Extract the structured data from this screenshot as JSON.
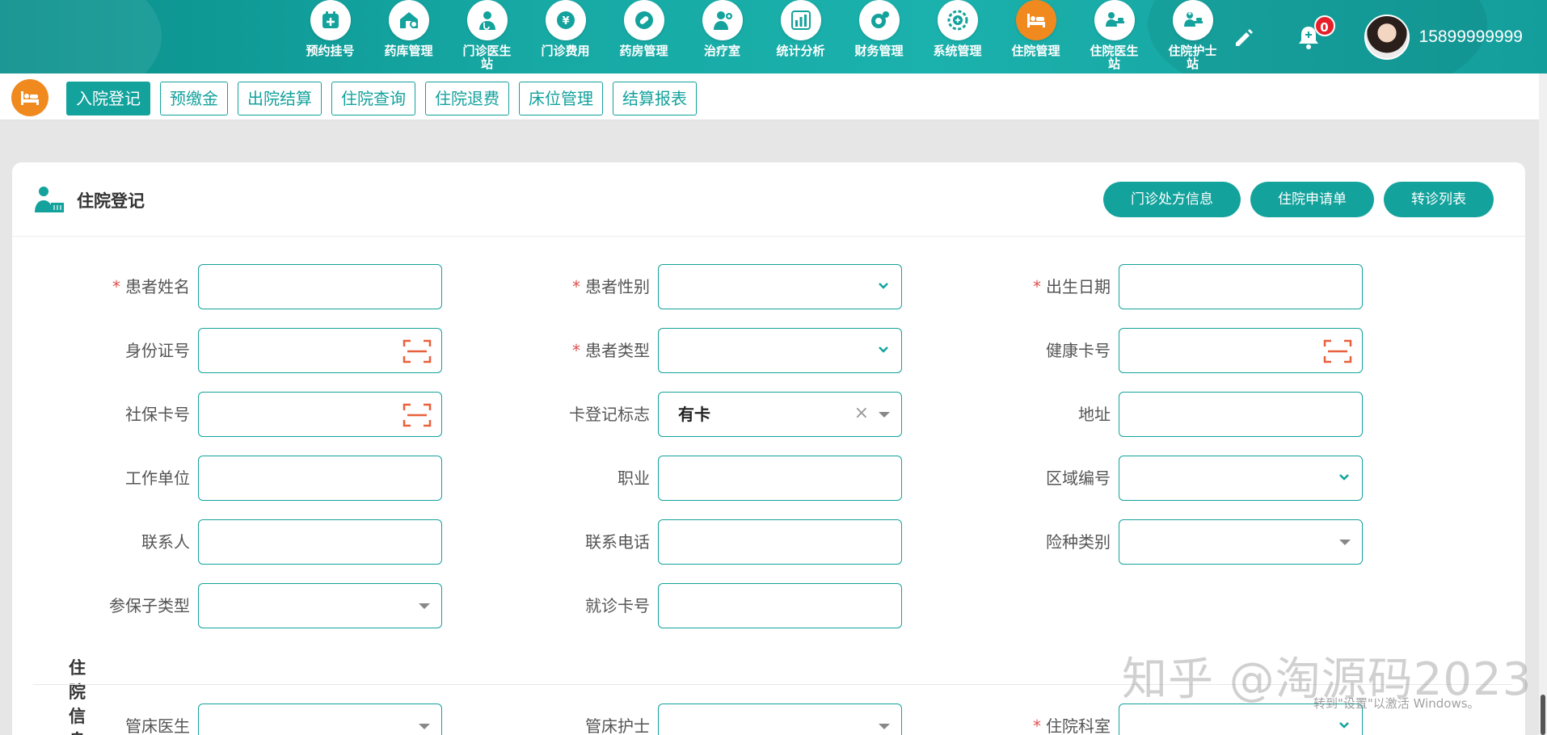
{
  "topnav": {
    "modules": [
      {
        "label": "预约挂号",
        "icon": "calendar-plus-icon",
        "active": false
      },
      {
        "label": "药库管理",
        "icon": "warehouse-icon",
        "active": false
      },
      {
        "label": "门诊医生站",
        "icon": "doctor-icon",
        "active": false
      },
      {
        "label": "门诊费用",
        "icon": "yen-coin-icon",
        "active": false
      },
      {
        "label": "药房管理",
        "icon": "pill-icon",
        "active": false
      },
      {
        "label": "治疗室",
        "icon": "nurse-treatment-icon",
        "active": false
      },
      {
        "label": "统计分析",
        "icon": "bar-chart-icon",
        "active": false
      },
      {
        "label": "财务管理",
        "icon": "finance-gear-icon",
        "active": false
      },
      {
        "label": "系统管理",
        "icon": "system-gear-icon",
        "active": false
      },
      {
        "label": "住院管理",
        "icon": "hospital-bed-icon",
        "active": true
      },
      {
        "label": "住院医生站",
        "icon": "inpatient-doctor-icon",
        "active": false
      },
      {
        "label": "住院护士站",
        "icon": "inpatient-nurse-icon",
        "active": false
      }
    ],
    "notification_count": "0",
    "user_phone": "15899999999"
  },
  "subnav": {
    "tabs": [
      {
        "label": "入院登记",
        "active": true
      },
      {
        "label": "预缴金",
        "active": false
      },
      {
        "label": "出院结算",
        "active": false
      },
      {
        "label": "住院查询",
        "active": false
      },
      {
        "label": "住院退费",
        "active": false
      },
      {
        "label": "床位管理",
        "active": false
      },
      {
        "label": "结算报表",
        "active": false
      }
    ]
  },
  "card": {
    "title": "住院登记",
    "buttons": {
      "prescription_info": "门诊处方信息",
      "admission_request": "住院申请单",
      "referral_list": "转诊列表"
    }
  },
  "form": {
    "patient_name": {
      "label": "患者姓名",
      "required": true,
      "value": ""
    },
    "patient_gender": {
      "label": "患者性别",
      "required": true,
      "value": ""
    },
    "birth_date": {
      "label": "出生日期",
      "required": true,
      "value": ""
    },
    "id_number": {
      "label": "身份证号",
      "required": false,
      "value": ""
    },
    "patient_type": {
      "label": "患者类型",
      "required": true,
      "value": ""
    },
    "health_card": {
      "label": "健康卡号",
      "required": false,
      "value": ""
    },
    "social_security_card": {
      "label": "社保卡号",
      "required": false,
      "value": ""
    },
    "card_registration_flag": {
      "label": "卡登记标志",
      "required": false,
      "value": "有卡"
    },
    "address": {
      "label": "地址",
      "required": false,
      "value": ""
    },
    "employer": {
      "label": "工作单位",
      "required": false,
      "value": ""
    },
    "occupation": {
      "label": "职业",
      "required": false,
      "value": ""
    },
    "region_code": {
      "label": "区域编号",
      "required": false,
      "value": ""
    },
    "contact_person": {
      "label": "联系人",
      "required": false,
      "value": ""
    },
    "contact_phone": {
      "label": "联系电话",
      "required": false,
      "value": ""
    },
    "insurance_type": {
      "label": "险种类别",
      "required": false,
      "value": ""
    },
    "insurance_subtype": {
      "label": "参保子类型",
      "required": false,
      "value": ""
    },
    "visit_card": {
      "label": "就诊卡号",
      "required": false,
      "value": ""
    },
    "section_inpatient": "住院信息",
    "bed_doctor": {
      "label": "管床医生",
      "required": false,
      "value": ""
    },
    "bed_nurse": {
      "label": "管床护士",
      "required": false,
      "value": ""
    },
    "inpatient_department": {
      "label": "住院科室",
      "required": true,
      "value": ""
    }
  },
  "overlay": {
    "watermark": "知乎 @淘源码2023",
    "windows_activation": "转到\"设置\"以激活 Windows。"
  },
  "colors": {
    "primary": "#13a29c",
    "accent_orange": "#f08a1f",
    "badge_red": "#e6202b",
    "required_red": "#e0504d"
  }
}
